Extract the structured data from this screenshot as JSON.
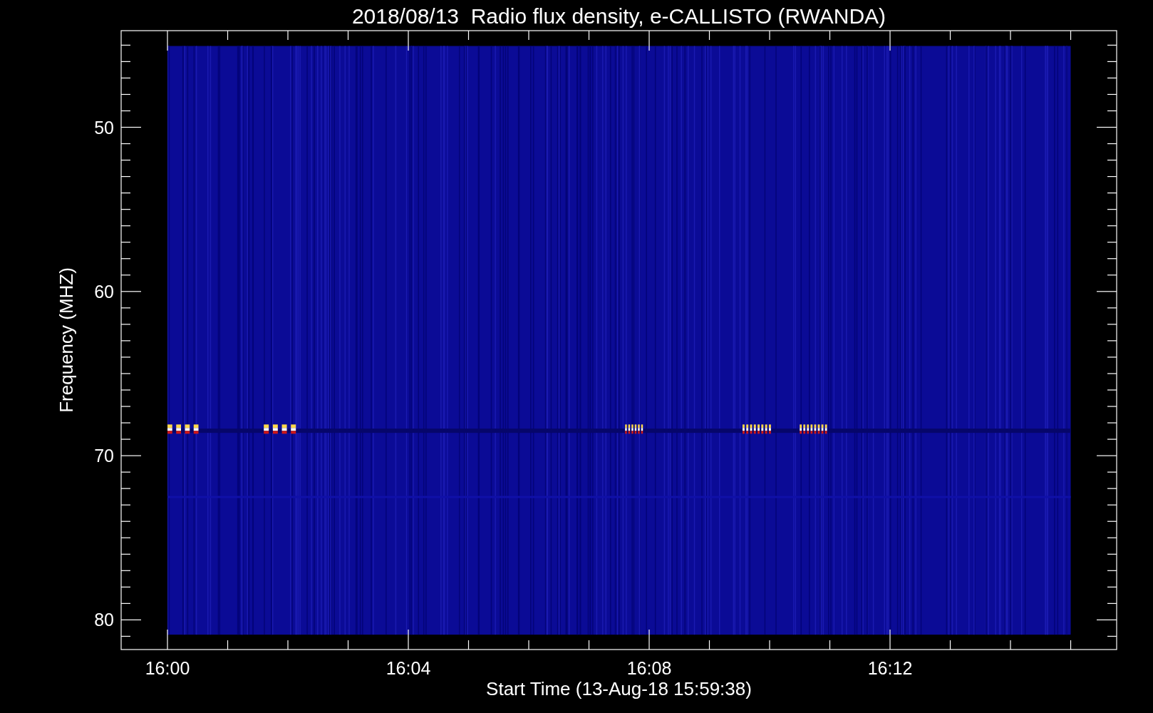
{
  "title": "2018/08/13  Radio flux density, e-CALLISTO (RWANDA)",
  "x_axis": {
    "label": "Start Time (13-Aug-18 15:59:38)",
    "ticks": [
      "16:00",
      "16:04",
      "16:08",
      "16:12"
    ]
  },
  "y_axis": {
    "label": "Frequency (MHZ)",
    "ticks": [
      "50",
      "60",
      "70",
      "80"
    ]
  }
}
